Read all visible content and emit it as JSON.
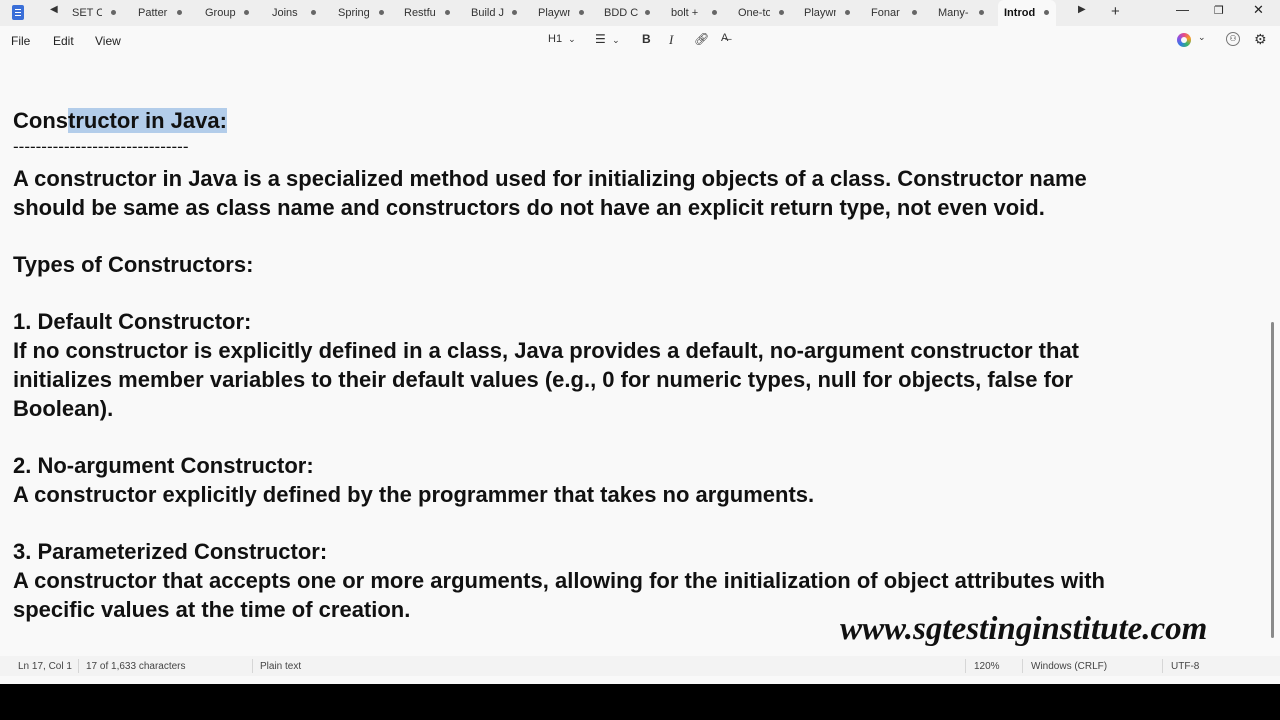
{
  "tabs": [
    {
      "label": "SET Op",
      "active": false
    },
    {
      "label": "Pattern",
      "active": false
    },
    {
      "label": "Group",
      "active": false
    },
    {
      "label": "Joins",
      "active": false
    },
    {
      "label": "Spring",
      "active": false
    },
    {
      "label": "Restful",
      "active": false
    },
    {
      "label": "Build J",
      "active": false
    },
    {
      "label": "Playwr",
      "active": false
    },
    {
      "label": "BDD C",
      "active": false
    },
    {
      "label": "bolt +",
      "active": false
    },
    {
      "label": "One-to",
      "active": false
    },
    {
      "label": "Playwr",
      "active": false
    },
    {
      "label": "Fonar",
      "active": false
    },
    {
      "label": "Many-",
      "active": false
    },
    {
      "label": "Introd",
      "active": true
    }
  ],
  "menu": {
    "file": "File",
    "edit": "Edit",
    "view": "View"
  },
  "toolbar": {
    "heading": "H1"
  },
  "document": {
    "title_plain": "Cons",
    "title_selected": "tructor in Java: ",
    "rule": "-------------------------------",
    "para1_line1": "A constructor in Java is a specialized method used for initializing objects of a class. Constructor name",
    "para1_line2": "should be same as class name and constructors do not have an explicit return type, not even void.",
    "types_heading": "Types of Constructors:",
    "default_heading": "1. Default Constructor:",
    "default_line1": "If no constructor is explicitly defined in a class, Java provides a default, no-argument constructor that",
    "default_line2": "initializes member variables to their default values (e.g., 0 for numeric types, null for objects, false for",
    "default_line3": "Boolean).",
    "noarg_heading": "2. No-argument Constructor:",
    "noarg_line1": "A constructor explicitly defined by the programmer that takes no arguments.",
    "param_heading": "3. Parameterized Constructor:",
    "param_line1": "A constructor that accepts one or more arguments, allowing for the initialization of object attributes with",
    "param_line2": "specific values at the time of creation."
  },
  "watermark": "www.sgtestinginstitute.com",
  "status": {
    "position": "Ln 17, Col 1",
    "characters": "17 of 1,633 characters",
    "format": "Plain text",
    "zoom": "120%",
    "line_ending": "Windows (CRLF)",
    "encoding": "UTF-8"
  },
  "colors": {
    "selection": "#b3cdea",
    "app_icon": "#3a6fd8"
  }
}
